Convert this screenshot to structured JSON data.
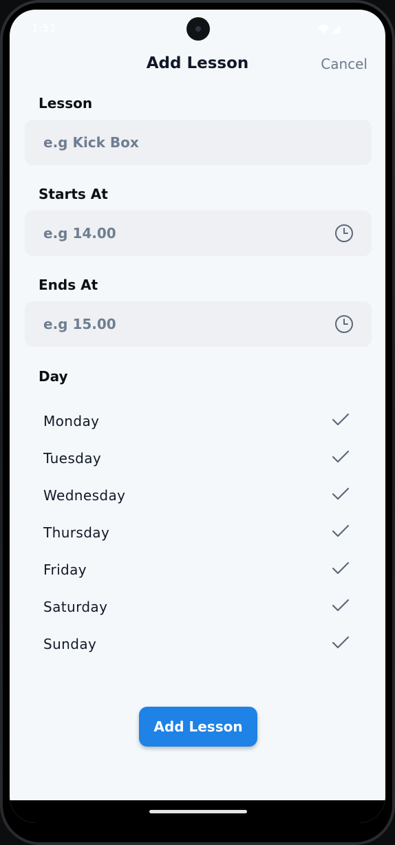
{
  "status_bar": {
    "time": "1:51"
  },
  "header": {
    "title": "Add Lesson",
    "cancel_label": "Cancel"
  },
  "form": {
    "lesson": {
      "label": "Lesson",
      "placeholder": "e.g Kick Box"
    },
    "starts_at": {
      "label": "Starts At",
      "placeholder": "e.g 14.00",
      "icon": "clock-icon"
    },
    "ends_at": {
      "label": "Ends At",
      "placeholder": "e.g 15.00",
      "icon": "clock-icon"
    }
  },
  "day_section": {
    "label": "Day",
    "days": [
      {
        "label": "Monday",
        "checked": true
      },
      {
        "label": "Tuesday",
        "checked": true
      },
      {
        "label": "Wednesday",
        "checked": true
      },
      {
        "label": "Thursday",
        "checked": true
      },
      {
        "label": "Friday",
        "checked": true
      },
      {
        "label": "Saturday",
        "checked": true
      },
      {
        "label": "Sunday",
        "checked": true
      }
    ]
  },
  "submit": {
    "label": "Add Lesson"
  },
  "colors": {
    "accent": "#1e82e6",
    "background": "#f4f8fb",
    "input_background": "#eef0f3",
    "placeholder": "#6f7e91",
    "check": "#5b6878"
  }
}
